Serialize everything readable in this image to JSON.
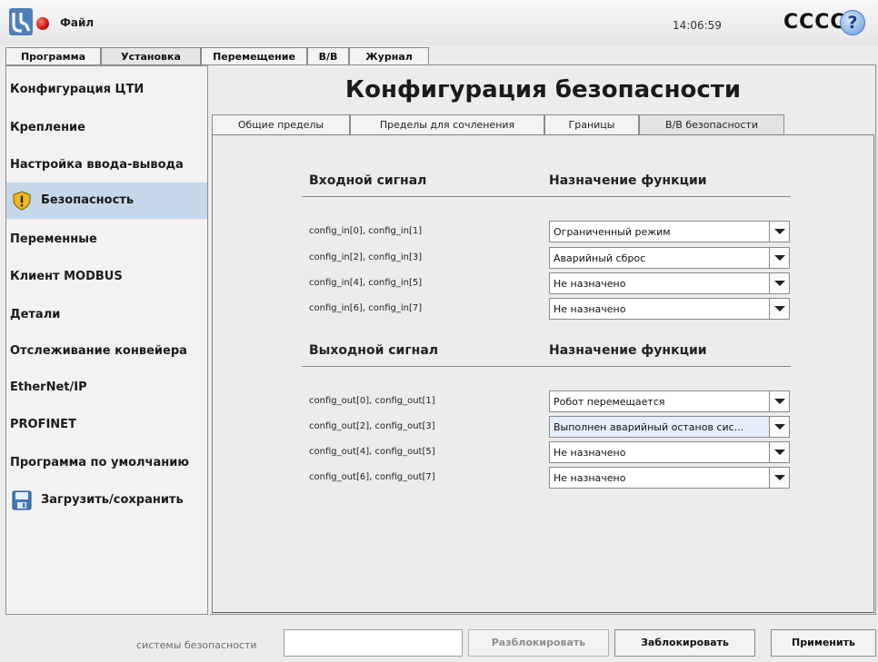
{
  "titlebar": {
    "file_menu": "Файл",
    "clock": "14:06:59",
    "robot_name": "CCCC",
    "help_label": "?"
  },
  "main_tabs": [
    {
      "label": "Программа"
    },
    {
      "label": "Установка"
    },
    {
      "label": "Перемещение"
    },
    {
      "label": "В/В"
    },
    {
      "label": "Журнал"
    }
  ],
  "main_tabs_active": "Установка",
  "sidebar": {
    "items": [
      {
        "label": "Конфигурация ЦТИ"
      },
      {
        "label": "Крепление"
      },
      {
        "label": "Настройка ввода-вывода"
      },
      {
        "label": "Безопасность"
      },
      {
        "label": "Переменные"
      },
      {
        "label": "Клиент MODBUS"
      },
      {
        "label": "Детали"
      },
      {
        "label": "Отслеживание конвейера"
      },
      {
        "label": "EtherNet/IP"
      },
      {
        "label": "PROFINET"
      },
      {
        "label": "Программа по умолчанию"
      },
      {
        "label": "Загрузить/сохранить"
      }
    ],
    "active": "Безопасность"
  },
  "content": {
    "title": "Конфигурация безопасности",
    "sub_tabs": [
      {
        "label": "Общие пределы"
      },
      {
        "label": "Пределы для сочленения"
      },
      {
        "label": "Границы"
      },
      {
        "label": "В/В безопасности"
      }
    ],
    "active_sub_tab": "В/В безопасности",
    "inputs": {
      "signal_header": "Входной сигнал",
      "function_header": "Назначение функции",
      "rows": [
        {
          "signal": "config_in[0], config_in[1]",
          "function": "Ограниченный режим"
        },
        {
          "signal": "config_in[2], config_in[3]",
          "function": "Аварийный сброс"
        },
        {
          "signal": "config_in[4], config_in[5]",
          "function": "Не назначено"
        },
        {
          "signal": "config_in[6], config_in[7]",
          "function": "Не назначено"
        }
      ]
    },
    "outputs": {
      "signal_header": "Выходной сигнал",
      "function_header": "Назначение функции",
      "rows": [
        {
          "signal": "config_out[0], config_out[1]",
          "function": "Робот перемещается"
        },
        {
          "signal": "config_out[2], config_out[3]",
          "function": "Выполнен аварийный останов сис..."
        },
        {
          "signal": "config_out[4], config_out[5]",
          "function": "Не назначено"
        },
        {
          "signal": "config_out[6], config_out[7]",
          "function": "Не назначено"
        }
      ]
    }
  },
  "footer": {
    "password_label": "системы безопасности",
    "password_value": "",
    "unlock_label": "Разблокировать",
    "lock_label": "Заблокировать",
    "apply_label": "Применить"
  },
  "colors": {
    "active_sidebar": "#c6d7ea",
    "status_dot": "#c8150c",
    "shield_icon": "#f0b81a",
    "help_icon": "#86b2e3",
    "highlighted_dropdown": "#e5eefb"
  }
}
